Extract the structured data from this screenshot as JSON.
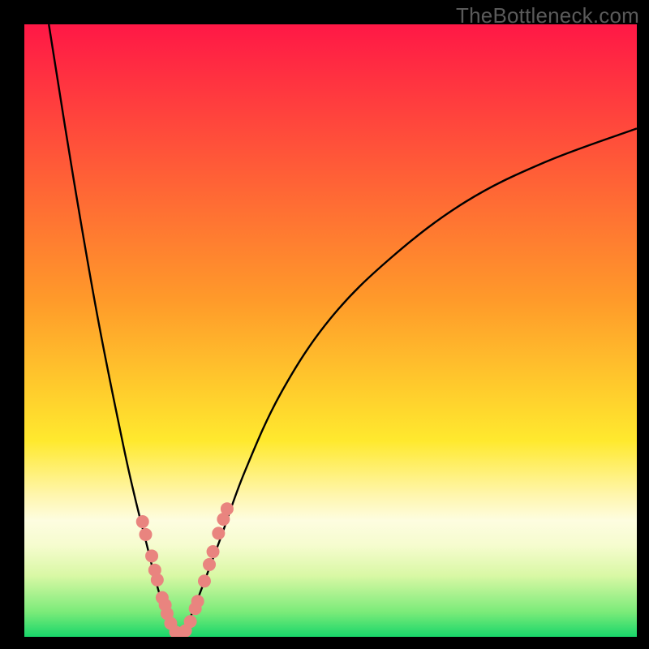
{
  "watermark": "TheBottleneck.com",
  "chart_data": {
    "type": "line",
    "title": "",
    "xlabel": "",
    "ylabel": "",
    "x_range": [
      0,
      100
    ],
    "y_range": [
      0,
      100
    ],
    "notch_x": 25,
    "gradient_stops": [
      {
        "offset": 0,
        "color": "#ff1846"
      },
      {
        "offset": 45,
        "color": "#ff9a2a"
      },
      {
        "offset": 68,
        "color": "#ffe92e"
      },
      {
        "offset": 77,
        "color": "#fff6af"
      },
      {
        "offset": 81,
        "color": "#fdfde0"
      },
      {
        "offset": 85,
        "color": "#f6fccf"
      },
      {
        "offset": 90,
        "color": "#d9f8a5"
      },
      {
        "offset": 96,
        "color": "#7aeb79"
      },
      {
        "offset": 100,
        "color": "#18d66a"
      }
    ],
    "series": [
      {
        "name": "left-branch",
        "type": "curve",
        "x": [
          4,
          8,
          12,
          16,
          18,
          20,
          21.5,
          23,
          24,
          25
        ],
        "y": [
          100,
          75,
          52,
          32,
          23,
          15,
          9,
          4,
          1.5,
          0
        ]
      },
      {
        "name": "right-branch",
        "type": "curve",
        "x": [
          25,
          27,
          29,
          32,
          36,
          42,
          50,
          60,
          72,
          85,
          100
        ],
        "y": [
          0,
          3,
          8,
          16,
          27,
          40,
          52,
          62,
          71,
          77.5,
          83
        ]
      },
      {
        "name": "left-dots",
        "type": "scatter",
        "x": [
          19.3,
          19.8,
          20.8,
          21.3,
          21.7,
          22.5,
          23.0,
          23.3,
          23.9,
          24.7,
          25.3
        ],
        "y": [
          18.8,
          16.7,
          13.2,
          10.9,
          9.3,
          6.4,
          5.2,
          3.8,
          2.2,
          0.8,
          0.4
        ],
        "color": "#e9847f",
        "r": 8
      },
      {
        "name": "right-dots",
        "type": "scatter",
        "x": [
          26.3,
          27.1,
          27.9,
          28.3,
          29.4,
          30.2,
          30.8,
          31.7,
          32.5,
          33.1
        ],
        "y": [
          1.0,
          2.5,
          4.6,
          5.8,
          9.1,
          11.8,
          13.9,
          16.9,
          19.2,
          20.9
        ],
        "color": "#e9847f",
        "r": 8
      }
    ]
  }
}
